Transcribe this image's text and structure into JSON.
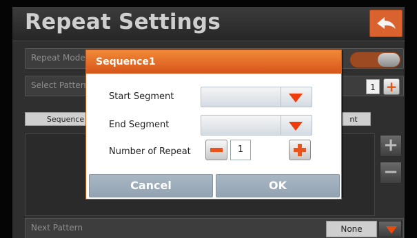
{
  "screen": {
    "title": "Repeat Settings",
    "back_icon": "back-arrow-icon"
  },
  "rows": {
    "repeat_mode_label": "Repeat Mode",
    "select_pattern_label": "Select Pattern",
    "pattern_count": "1",
    "next_pattern_label": "Next Pattern",
    "next_pattern_value": "None"
  },
  "tabs": {
    "sequence_label": "Sequence",
    "right_tab_label": "nt"
  },
  "side_buttons": {
    "add_symbol": "+",
    "remove_symbol": "−"
  },
  "dialog": {
    "title": "Sequence1",
    "start_segment_label": "Start Segment",
    "start_segment_value": "",
    "end_segment_label": "End Segment",
    "end_segment_value": "",
    "number_of_repeat_label": "Number of Repeat",
    "number_of_repeat_value": "1",
    "cancel_label": "Cancel",
    "ok_label": "OK"
  },
  "colors": {
    "accent_orange": "#e8541c",
    "dialog_button": "#9dadbc"
  }
}
